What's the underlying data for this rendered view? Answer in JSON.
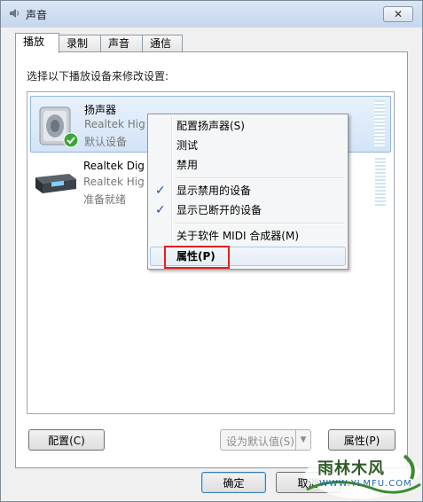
{
  "window": {
    "title": "声音",
    "close_glyph": "✕"
  },
  "tabs": [
    {
      "label": "播放",
      "active": true
    },
    {
      "label": "录制",
      "active": false
    },
    {
      "label": "声音",
      "active": false
    },
    {
      "label": "通信",
      "active": false
    }
  ],
  "panel": {
    "instruction": "选择以下播放设备来修改设置:"
  },
  "devices": [
    {
      "name": "扬声器",
      "line1": "Realtek Hig",
      "line2": "默认设备",
      "icon": "speaker-icon",
      "status_icon": "default-check-icon",
      "selected": true
    },
    {
      "name": "Realtek Dig",
      "line1": "Realtek Hig",
      "line2": "准备就绪",
      "icon": "digital-output-icon",
      "selected": false
    }
  ],
  "context_menu": {
    "items": [
      {
        "label": "配置扬声器(S)",
        "checked": false
      },
      {
        "label": "测试",
        "checked": false
      },
      {
        "label": "禁用",
        "checked": false
      },
      {
        "label": "显示禁用的设备",
        "checked": true
      },
      {
        "label": "显示已断开的设备",
        "checked": true
      },
      {
        "label": "关于软件 MIDI 合成器(M)",
        "checked": false
      },
      {
        "label": "属性(P)",
        "checked": false,
        "highlighted": true
      }
    ],
    "check_glyph": "✓"
  },
  "buttons": {
    "configure": "配置(C)",
    "set_default": "设为默认值(S)",
    "properties": "属性(P)",
    "ok": "确定",
    "cancel": "取消"
  },
  "watermark": {
    "text": "雨林木风",
    "sub": "WWW.YLMFU.COM"
  },
  "colors": {
    "highlight_border": "#e02020",
    "selection": "#d3e4f7",
    "check": "#1e4f9e"
  }
}
